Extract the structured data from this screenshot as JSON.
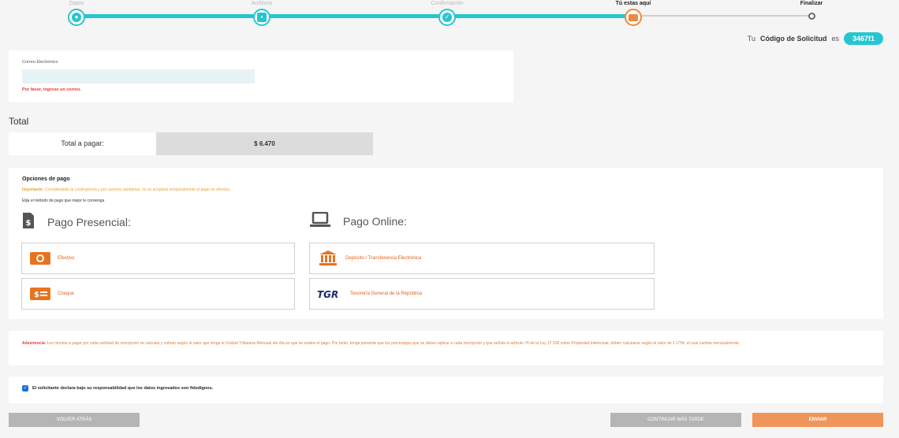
{
  "stepper": {
    "steps": [
      {
        "label": "Datos"
      },
      {
        "label": "Archivos"
      },
      {
        "label": "Confirmación"
      },
      {
        "label": "Tú estas aquí"
      },
      {
        "label": "Finalizar"
      }
    ]
  },
  "code": {
    "prefix": "Tu",
    "strong": "Código de Solicitud",
    "suffix": "es",
    "value": "3467f1"
  },
  "email": {
    "label": "Correo Electrónico",
    "value": "",
    "error": "Por favor, ingrese un correo."
  },
  "total": {
    "title": "Total",
    "label": "Total a pagar:",
    "value": "$ 6.470"
  },
  "payment": {
    "title": "Opciones de pago",
    "warning_strong": "Importante:",
    "warning_text": " Considerando la contingencia y por razones sanitarias, no se aceptará temporalmente el pago en efectivo.",
    "choose": "Elija el método de pago que mejor le convenga",
    "presencial_title": "Pago Presencial:",
    "online_title": "Pago Online:",
    "options": {
      "cash": "Efectivo",
      "check": "Cheque",
      "transfer": "Depósito / Transferencia Electrónica",
      "tgr": "Tesorería General de la República",
      "tgr_logo": "TGR"
    }
  },
  "warning": {
    "strong": "Advertencia:",
    "text": " Los montos a pagar por cada solicitud de inscripción se calculan y cobran según el valor que tenga el Unidad Tributaria Mensual del día en que se realice el pago. Por tanto, tenga presente que los porcentajes que se deben aplicar a cada inscripción y que señala el artículo 76 de la Ley 17.336 sobre Propiedad Intelectual, deben calcularse según el valor de 1 UTM, el cual cambia mensualmente."
  },
  "declaration": {
    "checked": true,
    "text": "El solicitante declara bajo su responsabilidad que los datos ingresados son fidedignos."
  },
  "buttons": {
    "back": "VOLVER ATRÁS",
    "later": "CONTINUAR MÁS TARDE",
    "send": "ENVIAR"
  },
  "colors": {
    "accent": "#26c6d0",
    "orange": "#f0883e",
    "error": "#e53935"
  }
}
